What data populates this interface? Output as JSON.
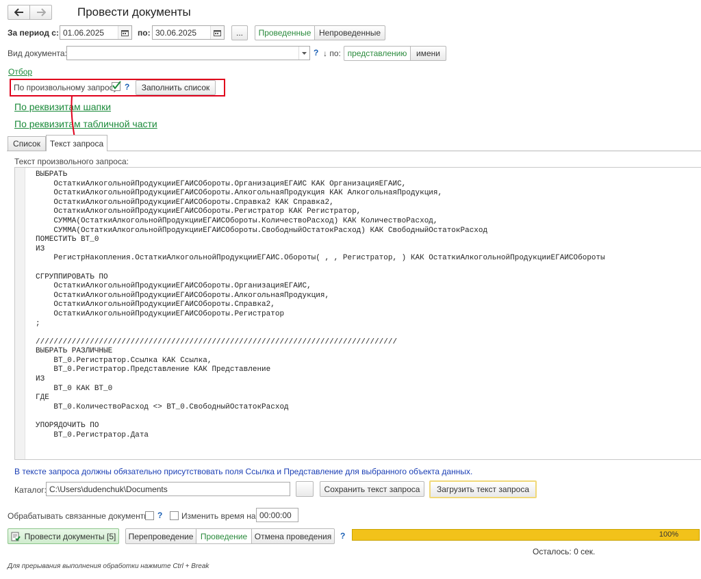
{
  "title": "Провести документы",
  "nav": {
    "back_icon": "arrow-left-icon",
    "forward_icon": "arrow-right-icon"
  },
  "period": {
    "from_label": "За период с:",
    "from_value": "01.06.2025",
    "to_label": "по:",
    "to_value": "30.06.2025",
    "more_label": "...",
    "status_options": [
      "Проведенные",
      "Непроведенные"
    ]
  },
  "doc_type": {
    "label": "Вид документа:",
    "value": "",
    "help": "?",
    "sort_label": "↓ по:",
    "sort_options": [
      "представлению",
      "имени"
    ]
  },
  "filter_link": "Отбор",
  "query_option": {
    "label": "По произвольному запросу:",
    "checked": true,
    "help": "?",
    "fill_button": "Заполнить список"
  },
  "links": {
    "header_attrs": "По реквизитам шапки",
    "table_attrs": "По реквизитам табличной части"
  },
  "tabs": [
    "Список",
    "Текст запроса"
  ],
  "query_text_label": "Текст произвольного запроса:",
  "query_text": "ВЫБРАТЬ\n    ОстаткиАлкогольнойПродукцииЕГАИСОбороты.ОрганизацияЕГАИС КАК ОрганизацияЕГАИС,\n    ОстаткиАлкогольнойПродукцииЕГАИСОбороты.АлкогольнаяПродукция КАК АлкогольнаяПродукция,\n    ОстаткиАлкогольнойПродукцииЕГАИСОбороты.Справка2 КАК Справка2,\n    ОстаткиАлкогольнойПродукцииЕГАИСОбороты.Регистратор КАК Регистратор,\n    СУММА(ОстаткиАлкогольнойПродукцииЕГАИСОбороты.КоличествоРасход) КАК КоличествоРасход,\n    СУММА(ОстаткиАлкогольнойПродукцииЕГАИСОбороты.СвободныйОстатокРасход) КАК СвободныйОстатокРасход\nПОМЕСТИТЬ ВТ_0\nИЗ\n    РегистрНакопления.ОстаткиАлкогольнойПродукцииЕГАИС.Обороты( , , Регистратор, ) КАК ОстаткиАлкогольнойПродукцииЕГАИСОбороты\n\nСГРУППИРОВАТЬ ПО\n    ОстаткиАлкогольнойПродукцииЕГАИСОбороты.ОрганизацияЕГАИС,\n    ОстаткиАлкогольнойПродукцииЕГАИСОбороты.АлкогольнаяПродукция,\n    ОстаткиАлкогольнойПродукцииЕГАИСОбороты.Справка2,\n    ОстаткиАлкогольнойПродукцииЕГАИСОбороты.Регистратор\n;\n\n////////////////////////////////////////////////////////////////////////////////\nВЫБРАТЬ РАЗЛИЧНЫЕ\n    ВТ_0.Регистратор.Ссылка КАК Ссылка,\n    ВТ_0.Регистратор.Представление КАК Представление\nИЗ\n    ВТ_0 КАК ВТ_0\nГДЕ\n    ВТ_0.КоличествоРасход <> ВТ_0.СвободныйОстатокРасход\n\nУПОРЯДОЧИТЬ ПО\n    ВТ_0.Регистратор.Дата",
  "info_text": "В тексте запроса должны обязательно присутствовать поля Ссылка и Представление для выбранного объекта данных.",
  "catalog": {
    "label": "Каталог:",
    "value": "C:\\Users\\dudenchuk\\Documents",
    "save_button": "Сохранить текст запроса",
    "load_button": "Загрузить текст запроса"
  },
  "options": {
    "process_linked_label": "Обрабатывать связанные документы:",
    "process_linked_checked": false,
    "help": "?",
    "change_time_label": "Изменить время на",
    "change_time_checked": false,
    "time_value": "00:00:00"
  },
  "actions": {
    "run_button": "Провести документы [5]",
    "modes": [
      "Перепроведение",
      "Проведение",
      "Отмена проведения"
    ],
    "active_mode": "Проведение",
    "help": "?"
  },
  "progress": {
    "percent": 100,
    "label": "100%"
  },
  "remaining": "Осталось:  0 сек.",
  "footer_hint": "Для прерывания выполнения обработки нажмите Ctrl + Break",
  "colors": {
    "accent_green": "#1b8a3a",
    "highlight_red": "#e0001b",
    "progress_yellow": "#f2c21a"
  }
}
